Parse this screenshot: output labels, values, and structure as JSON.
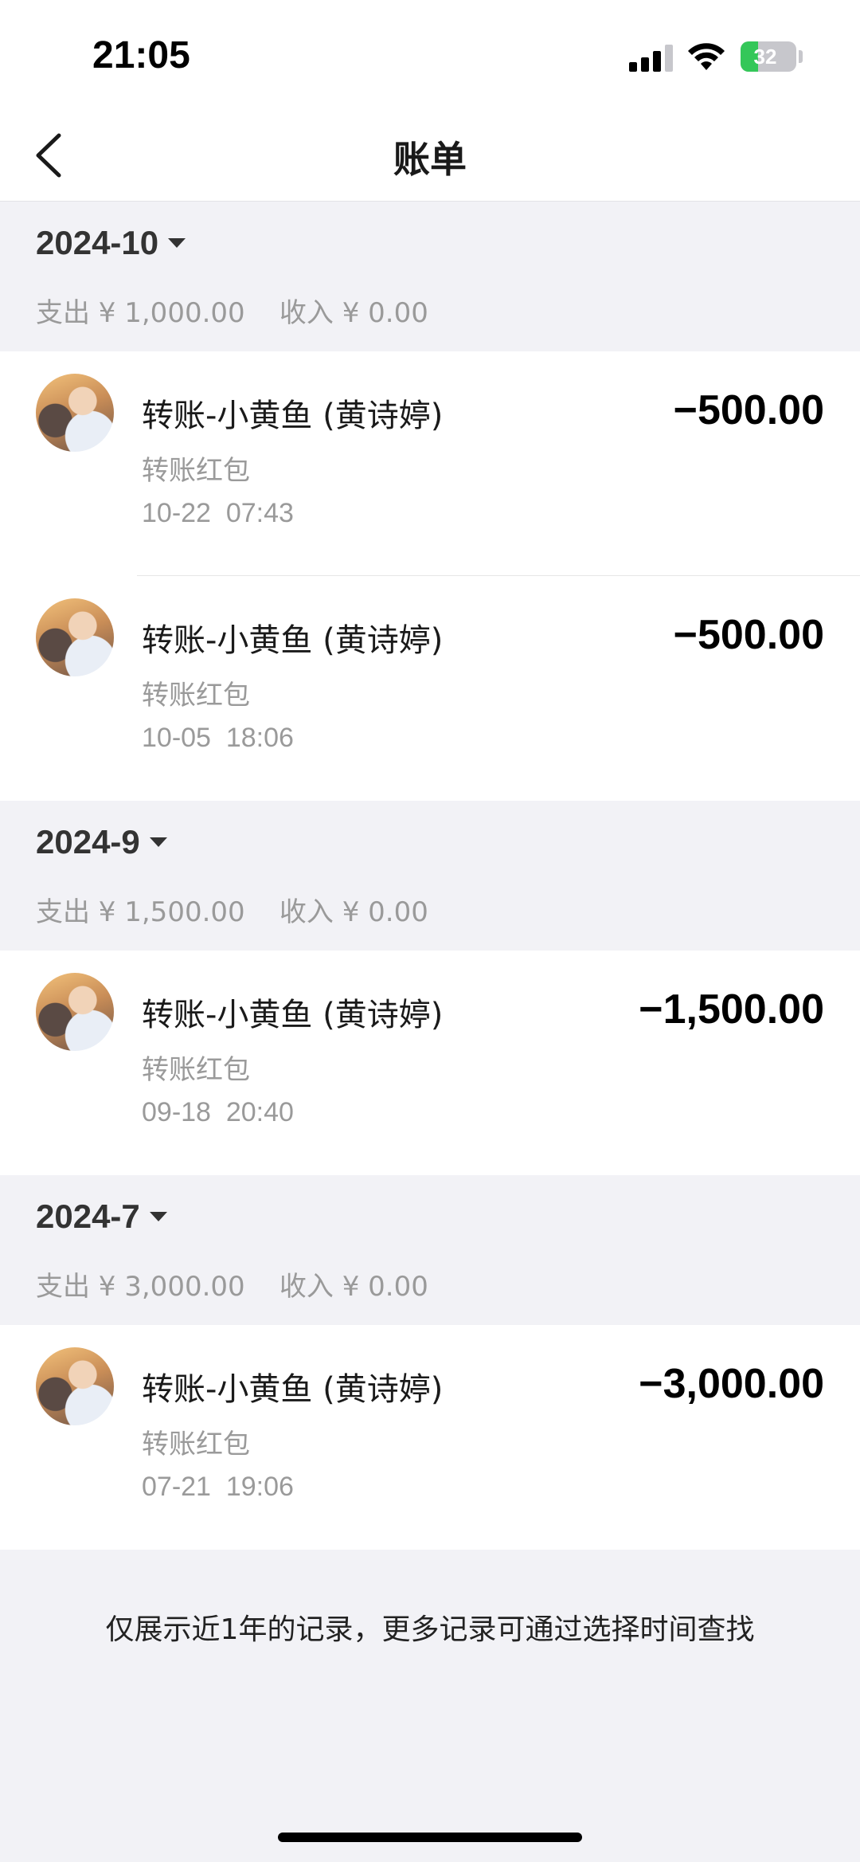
{
  "status_bar": {
    "time": "21:05",
    "battery_level": "32",
    "battery_fraction": 0.32,
    "icons": [
      "cellular-signal-icon",
      "wifi-icon",
      "battery-charging-icon"
    ]
  },
  "nav": {
    "title": "账单",
    "back_icon": "chevron-left-icon"
  },
  "months": [
    {
      "label": "2024-10",
      "summary": "支出 ¥ 1,000.00    收入 ¥ 0.00",
      "transactions": [
        {
          "title": "转账-小黄鱼 (黄诗婷)",
          "type": "转账红包",
          "time": "10-22  07:43",
          "amount": "−500.00"
        },
        {
          "title": "转账-小黄鱼 (黄诗婷)",
          "type": "转账红包",
          "time": "10-05  18:06",
          "amount": "−500.00"
        }
      ]
    },
    {
      "label": "2024-9",
      "summary": "支出 ¥ 1,500.00    收入 ¥ 0.00",
      "transactions": [
        {
          "title": "转账-小黄鱼 (黄诗婷)",
          "type": "转账红包",
          "time": "09-18  20:40",
          "amount": "−1,500.00"
        }
      ]
    },
    {
      "label": "2024-7",
      "summary": "支出 ¥ 3,000.00    收入 ¥ 0.00",
      "transactions": [
        {
          "title": "转账-小黄鱼 (黄诗婷)",
          "type": "转账红包",
          "time": "07-21  19:06",
          "amount": "−3,000.00"
        }
      ]
    }
  ],
  "footer_note": "仅展示近1年的记录，更多记录可通过选择时间查找",
  "colors": {
    "background": "#f2f2f6",
    "card": "#ffffff",
    "secondary_text": "#9a9a9a",
    "battery_green": "#34c759"
  }
}
